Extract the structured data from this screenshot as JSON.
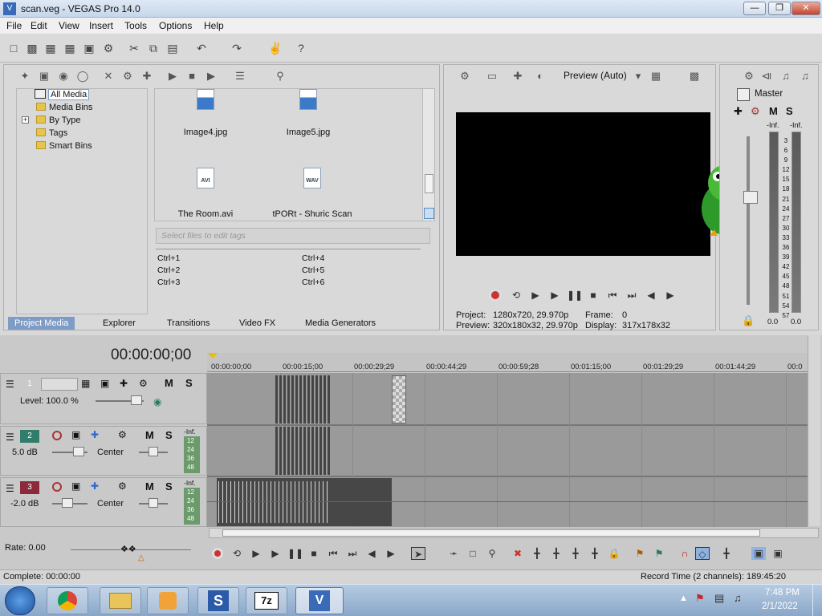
{
  "window": {
    "title": "scan.veg - VEGAS Pro 14.0",
    "btn_min": "—",
    "btn_max": "❐",
    "btn_close": "✕"
  },
  "menu": [
    "File",
    "Edit",
    "View",
    "Insert",
    "Tools",
    "Options",
    "Help"
  ],
  "media_tree": [
    "All Media",
    "Media Bins",
    "By Type",
    "Tags",
    "Smart Bins"
  ],
  "media_tree_expand": "+",
  "media_files": [
    {
      "name": "Image4.jpg",
      "type": ""
    },
    {
      "name": "Image5.jpg",
      "type": ""
    },
    {
      "name": "The Room.avi",
      "type": "AVI"
    },
    {
      "name": "tPORt - Shuric Scan",
      "type": "WAV"
    }
  ],
  "tags": {
    "placeholder": "Select files to edit tags",
    "shortcuts": [
      "Ctrl+1",
      "Ctrl+4",
      "Ctrl+2",
      "Ctrl+5",
      "Ctrl+3",
      "Ctrl+6"
    ]
  },
  "left_tabs": [
    "Project Media",
    "Explorer",
    "Transitions",
    "Video FX",
    "Media Generators"
  ],
  "preview": {
    "mode": "Preview (Auto)",
    "project_label": "Project:",
    "project_value": "1280x720, 29.970p",
    "frame_label": "Frame:",
    "frame_value": "0",
    "preview_label": "Preview:",
    "preview_value": "320x180x32, 29.970p",
    "display_label": "Display:",
    "display_value": "317x178x32"
  },
  "master": {
    "label": "Master",
    "m": "M",
    "s": "S",
    "inf_left": "-Inf.",
    "inf_right": "-Inf.",
    "scale": [
      "3",
      "6",
      "9",
      "12",
      "15",
      "18",
      "21",
      "24",
      "27",
      "30",
      "33",
      "36",
      "39",
      "42",
      "45",
      "48",
      "51",
      "54",
      "57"
    ],
    "val_left": "0.0",
    "val_right": "0.0"
  },
  "timecode": "00:00:00;00",
  "ruler": [
    "00:00:00;00",
    "00:00:15;00",
    "00:00:29;29",
    "00:00:44;29",
    "00:00:59;28",
    "00:01:15;00",
    "00:01:29;29",
    "00:01:44;29",
    "00:0"
  ],
  "tracks": [
    {
      "num": "1",
      "kind": "video",
      "color": "#7a7a2a",
      "level": "Level: 100.0 %",
      "m": "M",
      "s": "S"
    },
    {
      "num": "2",
      "kind": "audio",
      "color": "#2f7d6a",
      "vol": "5.0 dB",
      "pan": "Center",
      "m": "M",
      "s": "S",
      "inf": "-Inf.",
      "meter": [
        "12",
        "24",
        "36",
        "48"
      ]
    },
    {
      "num": "3",
      "kind": "audio",
      "color": "#8a2a3a",
      "vol": "-2.0 dB",
      "pan": "Center",
      "m": "M",
      "s": "S",
      "inf": "-Inf.",
      "meter": [
        "12",
        "24",
        "36",
        "48"
      ]
    }
  ],
  "rate": "Rate: 0.00",
  "status": {
    "left": "Complete: 00:00:00",
    "right": "Record Time (2 channels): 189:45:20"
  },
  "taskbar": {
    "time": "7:48 PM",
    "date": "2/1/2022"
  },
  "colors": {
    "accent": "#3f74c4",
    "video_bg": "#000000",
    "track_area": "#9a9a9a"
  }
}
